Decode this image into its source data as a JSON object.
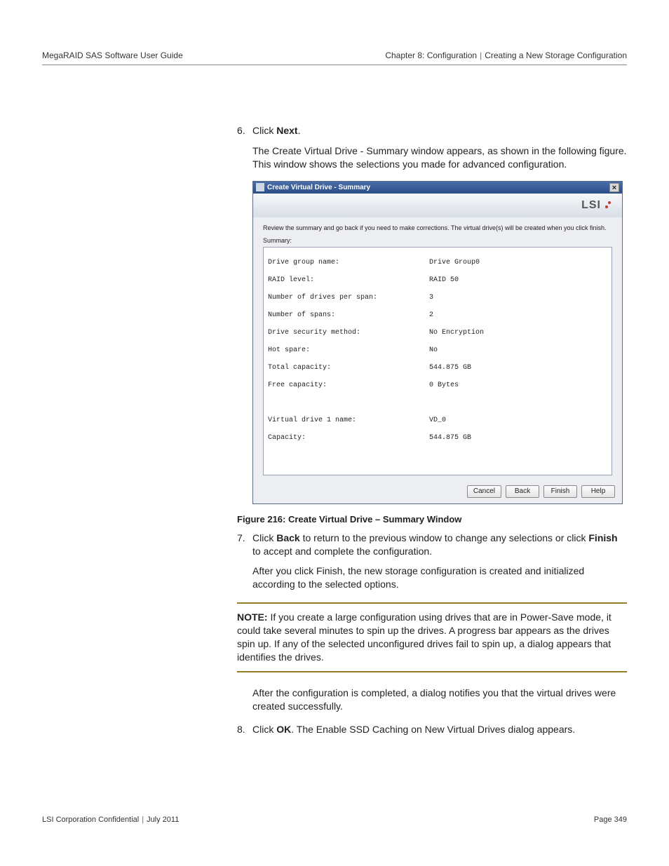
{
  "header": {
    "left": "MegaRAID SAS Software User Guide",
    "chapter": "Chapter 8: Configuration",
    "section": "Creating a New Storage Configuration"
  },
  "steps": {
    "s6_num": "6.",
    "s6_pre": "Click ",
    "s6_bold": "Next",
    "s6_post": ".",
    "s6_para": "The Create Virtual Drive - Summary window appears, as shown in the following figure. This window shows the selections you made for advanced configuration.",
    "s7_num": "7.",
    "s7_pre": "Click ",
    "s7_bold1": "Back",
    "s7_mid": " to return to the previous window to change any selections or click ",
    "s7_bold2": "Finish",
    "s7_post": " to accept and complete the configuration.",
    "s7_para_pre": "After you click ",
    "s7_para_bold": "Finish",
    "s7_para_post": ", the new storage configuration is created and initialized according to the selected options.",
    "s_after_note": "After the configuration is completed, a dialog notifies you that the virtual drives were created successfully.",
    "s8_num": "8.",
    "s8_pre": "Click ",
    "s8_bold": "OK",
    "s8_post": ". The Enable SSD Caching on New Virtual Drives dialog appears."
  },
  "shot": {
    "title": "Create Virtual Drive - Summary",
    "brand": "LSI",
    "tip": "Review the summary and go back if you need to make corrections. The virtual drive(s) will be created when you click finish.",
    "summary_label": "Summary:",
    "rows": {
      "k1": "Drive group name:",
      "v1": "Drive Group0",
      "k2": "RAID level:",
      "v2": "RAID 50",
      "k3": "Number of drives per span:",
      "v3": "3",
      "k4": "Number of spans:",
      "v4": "2",
      "k5": "Drive security method:",
      "v5": "No Encryption",
      "k6": "Hot spare:",
      "v6": "No",
      "k7": "Total capacity:",
      "v7": "544.875 GB",
      "k8": "Free capacity:",
      "v8": "0 Bytes",
      "k9": "Virtual drive 1 name:",
      "v9": "VD_0",
      "k10": "Capacity:",
      "v10": "544.875 GB"
    },
    "buttons": {
      "cancel": "Cancel",
      "back": "Back",
      "finish": "Finish",
      "help": "Help"
    }
  },
  "caption": "Figure 216:    Create Virtual Drive – Summary Window",
  "note": {
    "label": "NOTE:",
    "text": "  If you create a large configuration using drives that are in Power-Save mode, it could take several minutes to spin up the drives. A progress bar appears as the drives spin up. If any of the selected unconfigured drives fail to spin up, a dialog appears that identifies the drives."
  },
  "footer": {
    "left1": "LSI Corporation Confidential",
    "left2": "July 2011",
    "right": "Page 349"
  }
}
